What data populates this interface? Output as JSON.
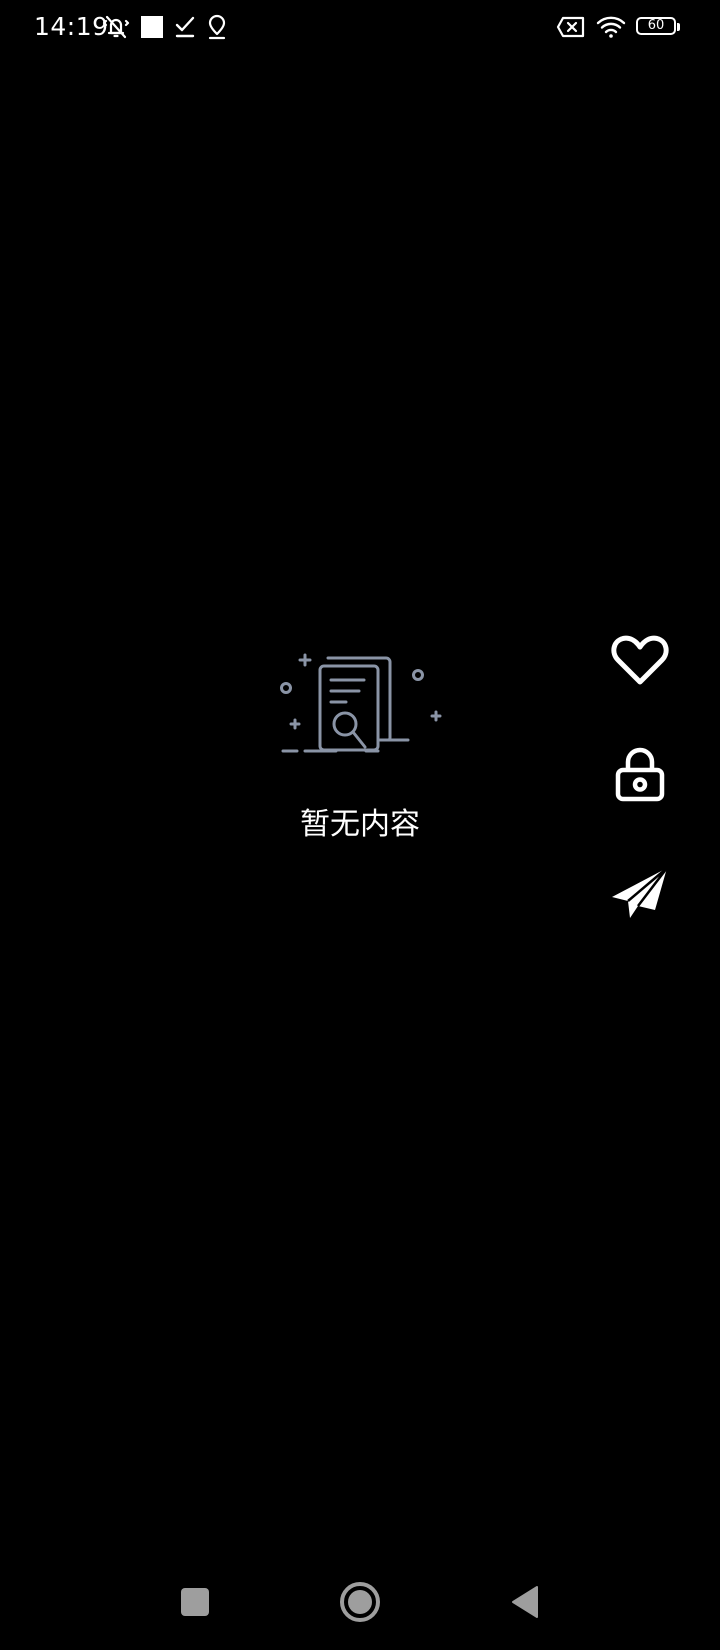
{
  "status_bar": {
    "time": "14:19",
    "battery_level": "60",
    "left_icons": [
      "vibrate-mute-icon",
      "square-notification-icon",
      "check-icon",
      "location-pin-icon"
    ],
    "right_icons": [
      "no-sim-icon",
      "wifi-icon",
      "battery-icon"
    ]
  },
  "empty_state": {
    "icon": "document-search-icon",
    "message": "暂无内容",
    "illustration_color": "#8a94a6"
  },
  "action_rail": {
    "items": [
      {
        "icon": "heart-icon",
        "action": "like"
      },
      {
        "icon": "lock-icon",
        "action": "lock"
      },
      {
        "icon": "paper-plane-icon",
        "action": "share"
      }
    ]
  },
  "nav_bar": {
    "items": [
      {
        "icon": "recents-square-icon"
      },
      {
        "icon": "home-circle-icon"
      },
      {
        "icon": "back-triangle-icon"
      }
    ],
    "color": "#9e9e9e"
  },
  "colors": {
    "background": "#000000",
    "foreground": "#ffffff"
  }
}
